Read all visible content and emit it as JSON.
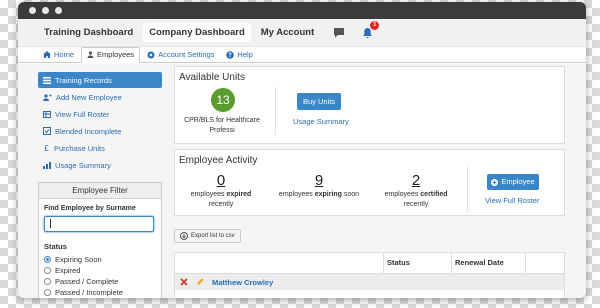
{
  "topnav": {
    "items": [
      "Training Dashboard",
      "Company Dashboard",
      "My Account"
    ],
    "notifications_count": "1"
  },
  "subnav": {
    "tabs": [
      "Home",
      "Employees",
      "Account Settings",
      "Help"
    ]
  },
  "sidebar": {
    "items": [
      "Training Records",
      "Add New Employee",
      "View Full Roster",
      "Blended Incomplete",
      "Purchase Units",
      "Usage Summary"
    ]
  },
  "filter": {
    "title": "Employee Filter",
    "search_label": "Find Employee by Surname",
    "search_value": "",
    "status_label": "Status",
    "options": [
      "Expiring Soon",
      "Expired",
      "Passed / Complete",
      "Passed / Incomplete"
    ],
    "selected": "Expiring Soon"
  },
  "units": {
    "title": "Available Units",
    "count": "13",
    "unit_name_line1": "CPR/BLS for Healthcare",
    "unit_name_line2": "Professi",
    "buy_label": "Buy Units",
    "usage_link": "Usage Summary"
  },
  "activity": {
    "title": "Employee Activity",
    "expired": {
      "num": "0",
      "pre": "employees ",
      "bold": "expired",
      "post": "",
      "line2": "recently"
    },
    "expiring": {
      "num": "9",
      "pre": "employees ",
      "bold": "expiring",
      "post": " soon",
      "line2": ""
    },
    "certified": {
      "num": "2",
      "pre": "employees ",
      "bold": "certified",
      "post": "",
      "line2": "recently"
    },
    "employee_button": "Employee",
    "roster_link": "View Full Roster"
  },
  "export_label": "Export list to csv",
  "table": {
    "headers": [
      "",
      "Status",
      "Renewal Date"
    ],
    "rows": [
      {
        "name": "Matthew Crowley",
        "status": "",
        "renewal": ""
      }
    ]
  },
  "colors": {
    "primary": "#3a86c8",
    "units_green": "#5b9c2f",
    "badge_red": "#e02424"
  }
}
